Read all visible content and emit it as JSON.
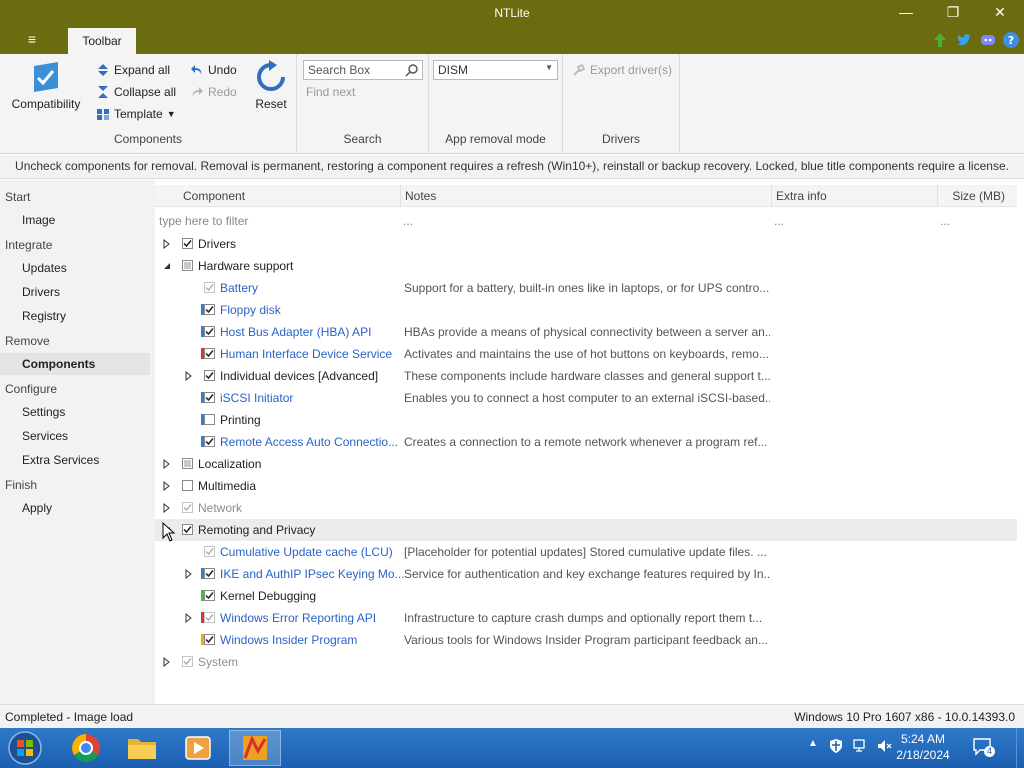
{
  "window": {
    "title": "NTLite",
    "minimize": "—",
    "restore": "❐",
    "close": "✕"
  },
  "ribbon": {
    "tab": "Toolbar",
    "menu": "≡",
    "groups": {
      "components": {
        "label": "Components",
        "compatibility": "Compatibility",
        "expand_all": "Expand all",
        "collapse_all": "Collapse all",
        "template": "Template",
        "undo": "Undo",
        "redo": "Redo",
        "reset": "Reset"
      },
      "search": {
        "label": "Search",
        "search_placeholder": "Search Box",
        "find_next": "Find next"
      },
      "app_removal": {
        "label": "App removal mode",
        "mode": "DISM"
      },
      "drivers": {
        "label": "Drivers",
        "export": "Export driver(s)"
      }
    }
  },
  "info": "Uncheck components for removal. Removal is permanent, restoring a component requires a refresh (Win10+), reinstall or backup recovery. Locked, blue title components require a license.",
  "sidebar": {
    "start": "Start",
    "image": "Image",
    "integrate": "Integrate",
    "updates": "Updates",
    "drivers": "Drivers",
    "registry": "Registry",
    "remove": "Remove",
    "components": "Components",
    "configure": "Configure",
    "settings": "Settings",
    "services": "Services",
    "extra_services": "Extra Services",
    "finish": "Finish",
    "apply": "Apply"
  },
  "grid": {
    "columns": {
      "component": "Component",
      "notes": "Notes",
      "extra": "Extra info",
      "size": "Size (MB)"
    },
    "filter": {
      "placeholder": "type here to filter",
      "notes": "...",
      "extra": "...",
      "size": "..."
    },
    "rows": [
      {
        "name": "Drivers",
        "note": ""
      },
      {
        "name": "Hardware support",
        "note": ""
      },
      {
        "name": "Battery",
        "note": "Support for a battery, built-in ones like in laptops, or for UPS contro..."
      },
      {
        "name": "Floppy disk",
        "note": ""
      },
      {
        "name": "Host Bus Adapter (HBA) API",
        "note": "HBAs provide a means of physical connectivity between a server an..."
      },
      {
        "name": "Human Interface Device Service",
        "note": "Activates and maintains the use of hot buttons on keyboards, remo..."
      },
      {
        "name": "Individual devices [Advanced]",
        "note": "These components include hardware classes and general support t..."
      },
      {
        "name": "iSCSI Initiator",
        "note": "Enables you to connect a host computer to an external iSCSI-based..."
      },
      {
        "name": "Printing",
        "note": ""
      },
      {
        "name": "Remote Access Auto Connectio...",
        "note": "Creates a connection to a remote network whenever a program ref..."
      },
      {
        "name": "Localization",
        "note": ""
      },
      {
        "name": "Multimedia",
        "note": ""
      },
      {
        "name": "Network",
        "note": ""
      },
      {
        "name": "Remoting and Privacy",
        "note": ""
      },
      {
        "name": "Cumulative Update cache (LCU)",
        "note": "[Placeholder for potential updates] Stored cumulative update files. ..."
      },
      {
        "name": "IKE and AuthIP IPsec Keying Mo...",
        "note": "Service for authentication and key exchange features required by In..."
      },
      {
        "name": "Kernel Debugging",
        "note": ""
      },
      {
        "name": "Windows Error Reporting API",
        "note": "Infrastructure to capture crash dumps and optionally report them t..."
      },
      {
        "name": "Windows Insider Program",
        "note": "Various tools for Windows Insider Program participant feedback an..."
      },
      {
        "name": "System",
        "note": ""
      }
    ]
  },
  "status": {
    "left": "Completed - Image load",
    "right": "Windows 10 Pro 1607 x86 - 10.0.14393.0"
  },
  "taskbar": {
    "time": "5:24 AM",
    "date": "2/18/2024",
    "notifications": "4"
  },
  "colors": {
    "titlebar": "#6b6b0f",
    "link": "#2a63c8",
    "bar_blue": "#3b7bd6",
    "bar_red": "#d23a3a",
    "bar_green": "#3fbf3f",
    "bar_yellow": "#e0b020"
  }
}
